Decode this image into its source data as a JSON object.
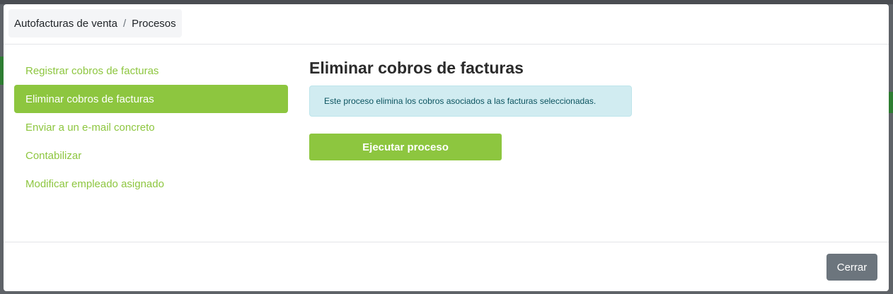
{
  "breadcrumb": {
    "parent": "Autofacturas de venta",
    "separator": "/",
    "current": "Procesos"
  },
  "sidebar": {
    "items": [
      {
        "label": "Registrar cobros de facturas",
        "active": false
      },
      {
        "label": "Eliminar cobros de facturas",
        "active": true
      },
      {
        "label": "Enviar a un e-mail concreto",
        "active": false
      },
      {
        "label": "Contabilizar",
        "active": false
      },
      {
        "label": "Modificar empleado asignado",
        "active": false
      }
    ]
  },
  "main": {
    "title": "Eliminar cobros de facturas",
    "info": "Este proceso elimina los cobros asociados a las facturas seleccionadas.",
    "run_button_label": "Ejecutar proceso"
  },
  "footer": {
    "close_label": "Cerrar"
  },
  "colors": {
    "accent": "#8dc63f",
    "info_bg": "#d1ecf1",
    "close_bg": "#6c757d"
  }
}
